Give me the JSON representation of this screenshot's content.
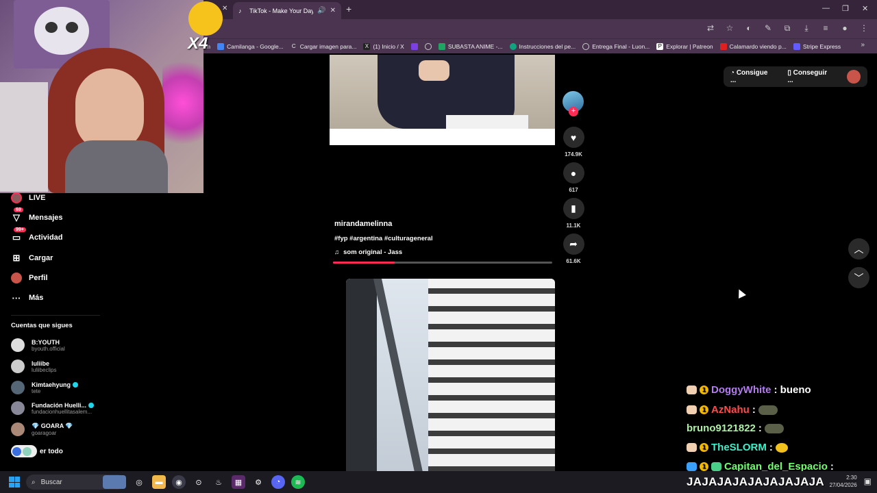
{
  "browser": {
    "tab_title": "TikTok - Make Your Day",
    "new_tab": "+",
    "window_controls": [
      "—",
      "❐",
      "✕"
    ],
    "bookmarks": [
      "m",
      "Camilanga - Google...",
      "Cargar imagen para...",
      "(1) Inicio / X",
      "",
      "",
      "SUBASTA ANIME -...",
      "Instrucciones del pe...",
      "Entrega Final - Luon...",
      "Explorar | Patreon",
      "Calamardo viendo p...",
      "Stripe Express"
    ],
    "bookmarks_more": "»"
  },
  "overlay": {
    "multiplier": "X4"
  },
  "sidebar": {
    "nav": [
      {
        "label": "LIVE",
        "icon": "live-icon",
        "badge": ""
      },
      {
        "label": "Mensajes",
        "icon": "messages-icon",
        "badge": "69"
      },
      {
        "label": "Actividad",
        "icon": "activity-icon",
        "badge": "99+"
      },
      {
        "label": "Cargar",
        "icon": "upload-icon",
        "badge": ""
      },
      {
        "label": "Perfil",
        "icon": "profile-icon",
        "badge": ""
      },
      {
        "label": "Más",
        "icon": "more-icon",
        "badge": ""
      }
    ],
    "following_title": "Cuentas que sigues",
    "following": [
      {
        "name": "B:YOUTH",
        "user": "byouth.official",
        "verified": false
      },
      {
        "name": "luliibe",
        "user": "luliibeclips",
        "verified": false
      },
      {
        "name": "Kimtaehyung",
        "user": "tete",
        "verified": true
      },
      {
        "name": "Fundación Huelli...",
        "user": "fundacionhuellitasalem...",
        "verified": true
      },
      {
        "name": "💎 GOARA 💎",
        "user": "goaragoar",
        "verified": false
      }
    ],
    "see_all": "er todo"
  },
  "post": {
    "author": "mirandamelinna",
    "tags": "#fyp #argentina #culturageneral",
    "music_icon": "♫",
    "music": "som original - Jass",
    "progress": 0.28,
    "likes": "174.9K",
    "comments": "617",
    "saves": "11.1K",
    "shares": "61.6K"
  },
  "topright": {
    "btn1": "Consigue ...",
    "btn2": "Conseguir ..."
  },
  "chat": [
    {
      "user": "DoggyWhite",
      "color": "#b57cf0",
      "msg": ": bueno"
    },
    {
      "user": "AzNahu",
      "color": "#ff4b4b",
      "msg": ":"
    },
    {
      "user": "bruno9121822",
      "color": "#aef0a8",
      "msg": ":"
    },
    {
      "user": "TheSLORM",
      "color": "#3ef0c8",
      "msg": ":"
    },
    {
      "user": "Capitan_del_Espacio",
      "color": "#6fff6f",
      "msg": ":"
    }
  ],
  "chat_last": "JAJAJAJAJAJAJAJAJA",
  "taskbar": {
    "search_placeholder": "Buscar",
    "time": "2:30",
    "date": "27/04/2026"
  }
}
